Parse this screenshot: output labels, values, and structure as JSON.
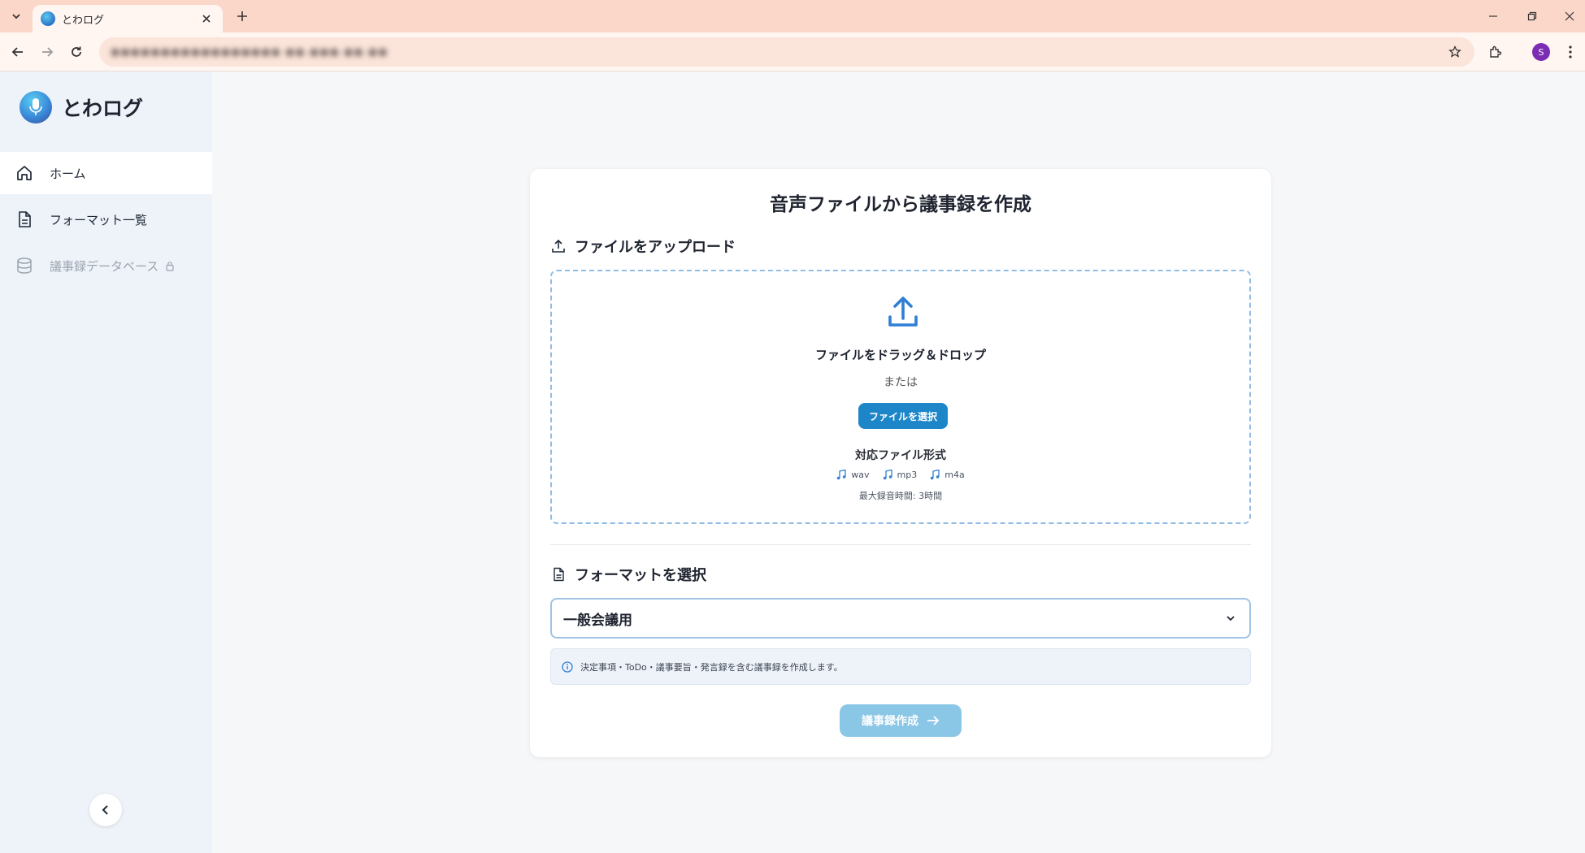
{
  "browser": {
    "tab_title": "とわログ",
    "url_masked": "●●●●●●●●●●●●●●●●● ●●.●●●.●●.●●",
    "profile_initial": "S",
    "colors": {
      "tabbar": "#fbd7c9",
      "toolbar": "#fff6f2",
      "profile": "#7b2cb3"
    }
  },
  "sidebar": {
    "brand": "とわログ",
    "items": [
      {
        "label": "ホーム",
        "icon": "home-icon",
        "active": true
      },
      {
        "label": "フォーマット一覧",
        "icon": "document-icon",
        "active": false
      },
      {
        "label": "議事録データベース",
        "icon": "database-icon",
        "active": false,
        "locked": true
      }
    ],
    "collapse_icon": "chevron-left-icon"
  },
  "main": {
    "title": "音声ファイルから議事録を作成",
    "upload": {
      "section_label": "ファイルをアップロード",
      "drop_text": "ファイルをドラッグ＆ドロップ",
      "or_text": "または",
      "select_button": "ファイルを選択",
      "formats_title": "対応ファイル形式",
      "formats": [
        "wav",
        "mp3",
        "m4a"
      ],
      "max_duration": "最大録音時間: 3時間"
    },
    "format": {
      "section_label": "フォーマットを選択",
      "selected": "一般会議用",
      "description": "決定事項・ToDo・議事要旨・発言録を含む議事録を作成します。"
    },
    "submit_label": "議事録作成",
    "colors": {
      "accent": "#1d86c8",
      "accent_disabled": "#8ac6e6",
      "dropzone_border": "#90bde6"
    }
  }
}
